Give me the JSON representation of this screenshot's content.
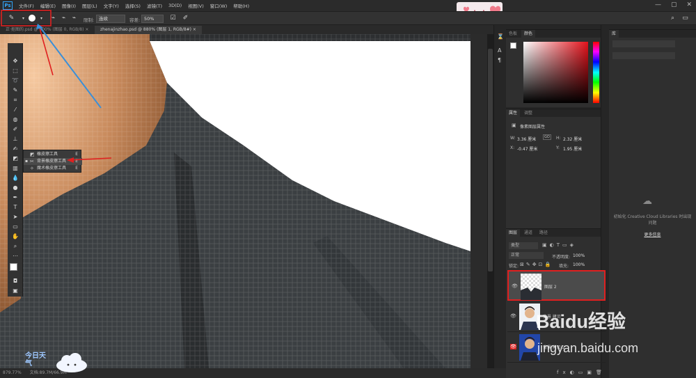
{
  "menubar": {
    "logo": "Ps",
    "items": [
      "文件(F)",
      "编辑(E)",
      "图像(I)",
      "图层(L)",
      "文字(Y)",
      "选择(S)",
      "滤镜(T)",
      "3D(D)",
      "视图(V)",
      "窗口(W)",
      "帮助(H)"
    ]
  },
  "options": {
    "limits_label": "限制:",
    "limits_value": "连续",
    "tolerance_label": "容差:",
    "tolerance_value": "50%"
  },
  "tabs": [
    {
      "label": "正·抠图的.psd @ 100% (图层 0, RGB/8) ×"
    },
    {
      "label": "zhenajinzhao.psd @ 880% (图层 1, RGB/8#) ×"
    }
  ],
  "flyout": {
    "items": [
      {
        "label": "橡皮擦工具",
        "key": "E",
        "selected": false
      },
      {
        "label": "背景橡皮擦工具",
        "key": "E",
        "selected": true
      },
      {
        "label": "魔术橡皮擦工具",
        "key": "E",
        "selected": false
      }
    ]
  },
  "status": {
    "zoom": "879.77%",
    "doc": "文档:89.7M/66.9M"
  },
  "color_panel": {
    "tabs": [
      "色板",
      "颜色"
    ],
    "active_tab": 1
  },
  "props_panel": {
    "tabs": [
      "属性",
      "调整"
    ],
    "title": "像素图层属性",
    "w_label": "W:",
    "w_value": "3.36 厘米",
    "h_label": "H:",
    "h_value": "2.32 厘米",
    "x_label": "X:",
    "x_value": "-0.47 厘米",
    "y_label": "Y:",
    "y_value": "1.95 厘米",
    "link_glyph": "GO"
  },
  "layers_panel": {
    "tabs": [
      "图层",
      "通道",
      "路径"
    ],
    "kind_label": "类型",
    "blend_mode": "正常",
    "opacity_label": "不透明度:",
    "opacity_value": "100%",
    "lock_label": "锁定:",
    "fill_label": "填充:",
    "fill_value": "100%",
    "layers": [
      {
        "name": "图层 2",
        "selected": true
      },
      {
        "name": "背景 拷贝",
        "selected": false
      },
      {
        "name": "背景 拷贝 2",
        "selected": false
      }
    ]
  },
  "libs_panel": {
    "tab": "库",
    "message": "初始化 Creative Cloud Libraries 时出现问题",
    "link": "更多信息"
  },
  "watermark": {
    "brand": "Baidu经验",
    "url": "jingyan.baidu.com",
    "corner": "今日天气"
  },
  "colors": {
    "annotation_red": "#e02020",
    "annotation_blue": "#3a8fd8",
    "accent": "#31a8ff"
  }
}
